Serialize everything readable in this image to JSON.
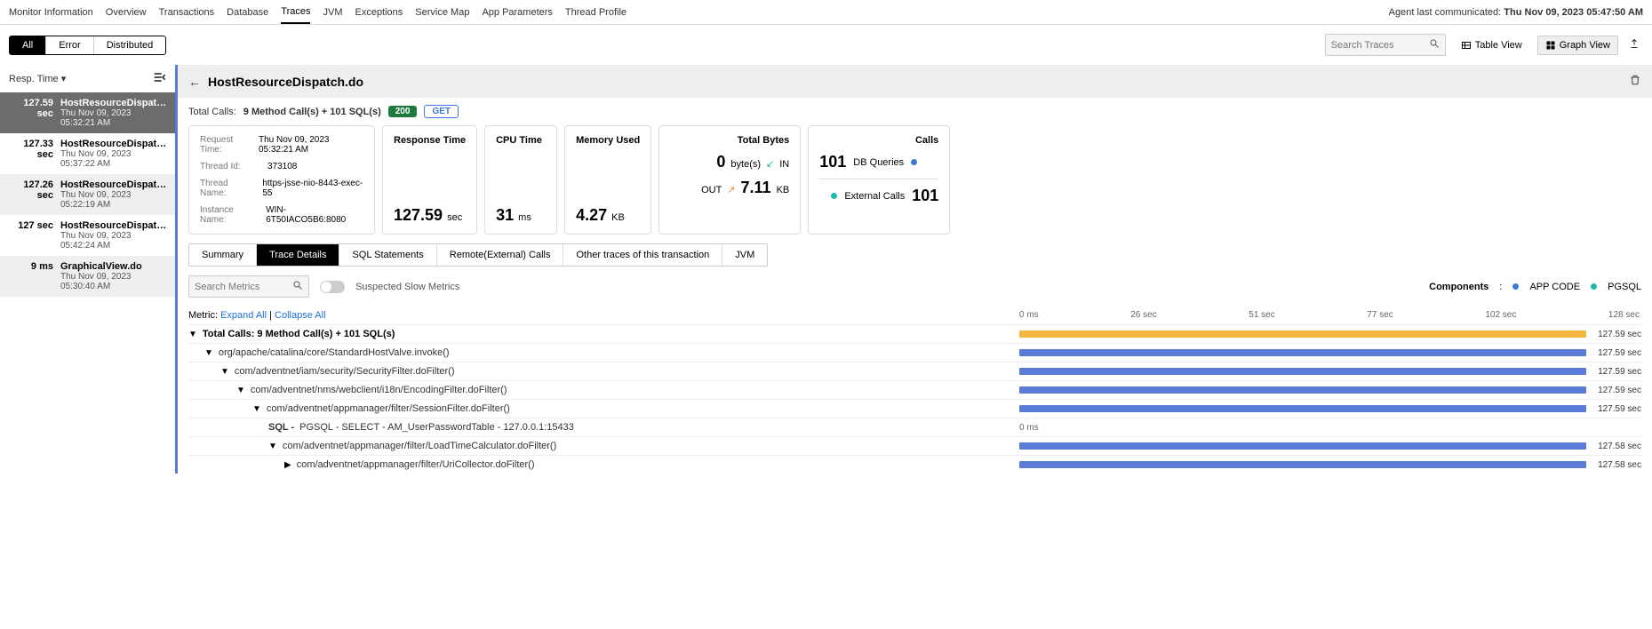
{
  "topnav": {
    "tabs": [
      "Monitor Information",
      "Overview",
      "Transactions",
      "Database",
      "Traces",
      "JVM",
      "Exceptions",
      "Service Map",
      "App Parameters",
      "Thread Profile"
    ],
    "agent_label": "Agent last communicated: ",
    "agent_time": "Thu Nov 09, 2023 05:47:50 AM"
  },
  "filters": {
    "all": "All",
    "error": "Error",
    "distributed": "Distributed"
  },
  "search_traces_ph": "Search Traces",
  "table_view": "Table View",
  "graph_view": "Graph View",
  "sort_label": "Resp. Time",
  "trace_list": [
    {
      "time": "127.59 sec",
      "name": "HostResourceDispatch.do",
      "ts": "Thu Nov 09, 2023 05:32:21 AM",
      "sel": true
    },
    {
      "time": "127.33 sec",
      "name": "HostResourceDispatch.do",
      "ts": "Thu Nov 09, 2023 05:37:22 AM"
    },
    {
      "time": "127.26 sec",
      "name": "HostResourceDispatch.do",
      "ts": "Thu Nov 09, 2023 05:22:19 AM"
    },
    {
      "time": "127 sec",
      "name": "HostResourceDispatch.do",
      "ts": "Thu Nov 09, 2023 05:42:24 AM"
    },
    {
      "time": "9 ms",
      "name": "GraphicalView.do",
      "ts": "Thu Nov 09, 2023 05:30:40 AM"
    }
  ],
  "pane": {
    "title": "HostResourceDispatch.do",
    "total_calls_label": "Total Calls:",
    "total_calls_value": "9 Method Call(s) + 101 SQL(s)",
    "status": "200",
    "method": "GET",
    "details": {
      "request_time_lbl": "Request Time:",
      "request_time": "Thu Nov 09, 2023 05:32:21 AM",
      "thread_id_lbl": "Thread Id:",
      "thread_id": "373108",
      "thread_name_lbl": "Thread Name:",
      "thread_name": "https-jsse-nio-8443-exec-55",
      "instance_lbl": "Instance Name:",
      "instance": "WIN-6T50IACO5B6:8080"
    },
    "kpi": {
      "resp_lbl": "Response Time",
      "resp": "127.59",
      "resp_unit": "sec",
      "cpu_lbl": "CPU Time",
      "cpu": "31",
      "cpu_unit": "ms",
      "mem_lbl": "Memory Used",
      "mem": "4.27",
      "mem_unit": "KB",
      "bytes_lbl": "Total Bytes",
      "in_big": "0",
      "in_unit": "byte(s)",
      "in_lbl": "IN",
      "out_lbl": "OUT",
      "out": "7.11",
      "out_unit": "KB",
      "calls_lbl": "Calls",
      "db_calls": "101",
      "db_q": "DB Queries",
      "ext_lbl": "External Calls",
      "ext_calls": "101"
    }
  },
  "dtabs": [
    "Summary",
    "Trace Details",
    "SQL Statements",
    "Remote(External) Calls",
    "Other traces of this transaction",
    "JVM"
  ],
  "metrics": {
    "search_ph": "Search Metrics",
    "sus_lbl": "Suspected Slow Metrics",
    "components_lbl": "Components",
    "c1": "APP CODE",
    "c2": "PGSQL"
  },
  "timeline": {
    "metric_lbl": "Metric:",
    "expand": "Expand All",
    "collapse": "Collapse All",
    "ticks": [
      "0 ms",
      "26 sec",
      "51 sec",
      "77 sec",
      "102 sec",
      "128 sec"
    ]
  },
  "tree": [
    {
      "indent": 0,
      "root": true,
      "lbl": "Total Calls: 9 Method Call(s) + 101 SQL(s)",
      "bar": "orange",
      "dur": "127.59 sec"
    },
    {
      "indent": 1,
      "lbl": "org/apache/catalina/core/StandardHostValve.invoke()",
      "bar": "blue",
      "dur": "127.59 sec"
    },
    {
      "indent": 2,
      "lbl": "com/adventnet/iam/security/SecurityFilter.doFilter()",
      "bar": "blue",
      "dur": "127.59 sec"
    },
    {
      "indent": 3,
      "lbl": "com/adventnet/nms/webclient/i18n/EncodingFilter.doFilter()",
      "bar": "blue",
      "dur": "127.59 sec"
    },
    {
      "indent": 4,
      "lbl": "com/adventnet/appmanager/filter/SessionFilter.doFilter()",
      "bar": "blue",
      "dur": "127.59 sec"
    },
    {
      "indent": 5,
      "sql": true,
      "prefix": "SQL - ",
      "lbl": "PGSQL - SELECT - AM_UserPasswordTable - 127.0.0.1:15433",
      "bar": "none",
      "dur": "0 ms"
    },
    {
      "indent": 5,
      "lbl": "com/adventnet/appmanager/filter/LoadTimeCalculator.doFilter()",
      "bar": "blue",
      "dur": "127.58 sec"
    },
    {
      "indent": 6,
      "closed": true,
      "lbl": "com/adventnet/appmanager/filter/UriCollector.doFilter()",
      "bar": "blue",
      "dur": "127.58 sec"
    }
  ]
}
